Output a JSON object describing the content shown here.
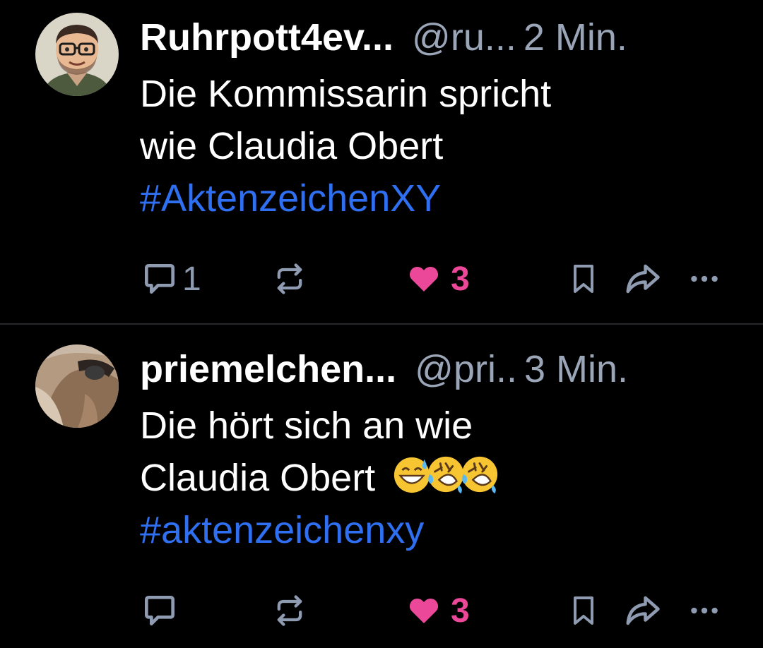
{
  "posts": [
    {
      "display_name": "Ruhrpott4ev...",
      "handle": "@ru...",
      "time": "2 Min.",
      "text_lines": [
        "Die Kommissarin spricht",
        "wie Claudia Obert"
      ],
      "hashtag": "#AktenzeichenXY",
      "emojis": [],
      "reply_count": "1",
      "like_count": "3",
      "avatar_icon": "memoji-avatar-icon"
    },
    {
      "display_name": "priemelchen...",
      "handle": "@pri..",
      "time": "3 Min.",
      "text_lines": [
        "Die hört sich an wie",
        "Claudia Obert"
      ],
      "hashtag": "#aktenzeichenxy",
      "emojis": [
        "grinning-sweat-emoji",
        "rolling-laughing-emoji",
        "rolling-laughing-emoji"
      ],
      "reply_count": "",
      "like_count": "3",
      "avatar_icon": "photo-avatar-icon"
    }
  ],
  "colors": {
    "background": "#000000",
    "secondary_text": "#9aa6b8",
    "hashtag": "#2f6ff2",
    "like": "#ec4899",
    "divider": "#26282c"
  }
}
